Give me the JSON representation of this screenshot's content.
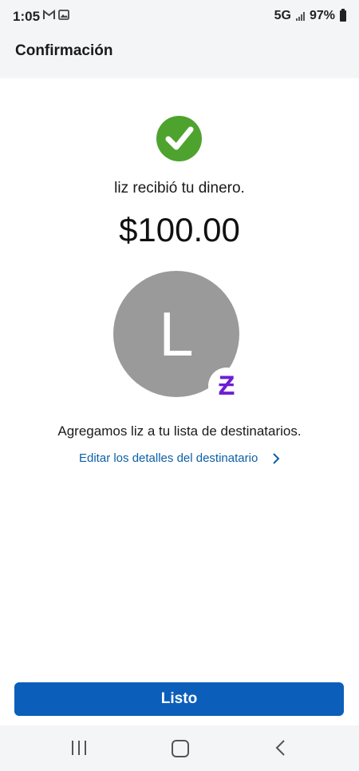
{
  "status_bar": {
    "time": "1:05",
    "network": "5G",
    "battery": "97%",
    "icons": [
      "gmail-icon",
      "gallery-icon",
      "signal-icon",
      "battery-icon"
    ]
  },
  "header": {
    "title": "Confirmación"
  },
  "confirmation": {
    "status_icon": "check-circle-icon",
    "status_color": "#4ea32e",
    "message": "liz recibió tu dinero.",
    "amount": "$100.00"
  },
  "recipient": {
    "avatar_initial": "L",
    "avatar_color": "#9a9a9a",
    "badge_icon": "zelle-icon",
    "badge_glyph": "Ƶ",
    "badge_color": "#6d1ed4",
    "added_message": "Agregamos liz a tu lista de destinatarios.",
    "edit_link_label": "Editar los detalles del destinatario",
    "edit_link_icon": "chevron-right-icon"
  },
  "actions": {
    "done_label": "Listo",
    "accent_color": "#0b5fba"
  },
  "nav_bar": {
    "icons": [
      "recents-icon",
      "home-icon",
      "back-icon"
    ]
  }
}
